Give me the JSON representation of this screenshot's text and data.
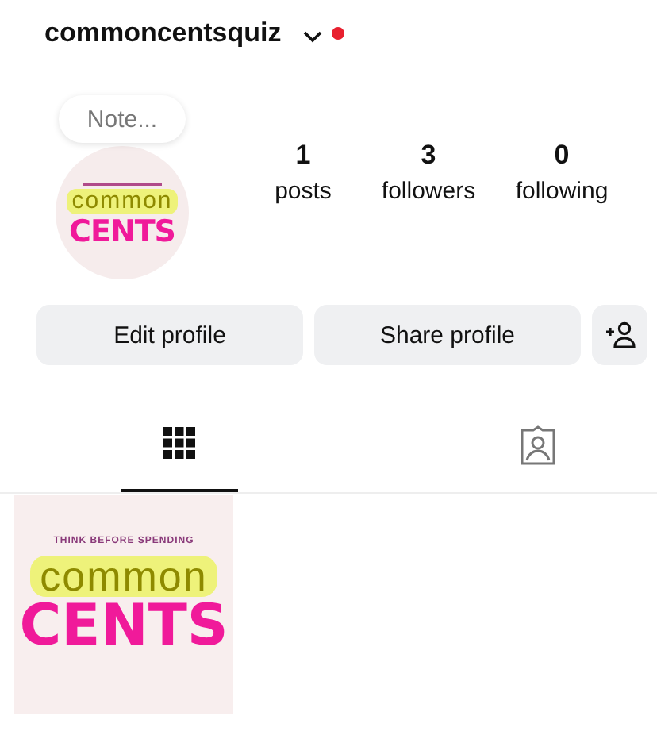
{
  "header": {
    "username": "commoncentsquiz",
    "has_notification": true
  },
  "profile": {
    "note": "Note...",
    "avatar_logo": {
      "word1": "common",
      "word2": "CENTS"
    },
    "stats": [
      {
        "value": "1",
        "label": "posts"
      },
      {
        "value": "3",
        "label": "followers"
      },
      {
        "value": "0",
        "label": "following"
      }
    ]
  },
  "buttons": [
    {
      "label": "Edit profile"
    },
    {
      "label": "Share profile"
    }
  ],
  "tabs": [
    {
      "kind": "grid",
      "selected": true
    },
    {
      "kind": "tagged",
      "selected": false
    }
  ],
  "posts": [
    {
      "tagline": "THINK BEFORE SPENDING",
      "word1": "common",
      "word2": "CENTS"
    }
  ]
}
